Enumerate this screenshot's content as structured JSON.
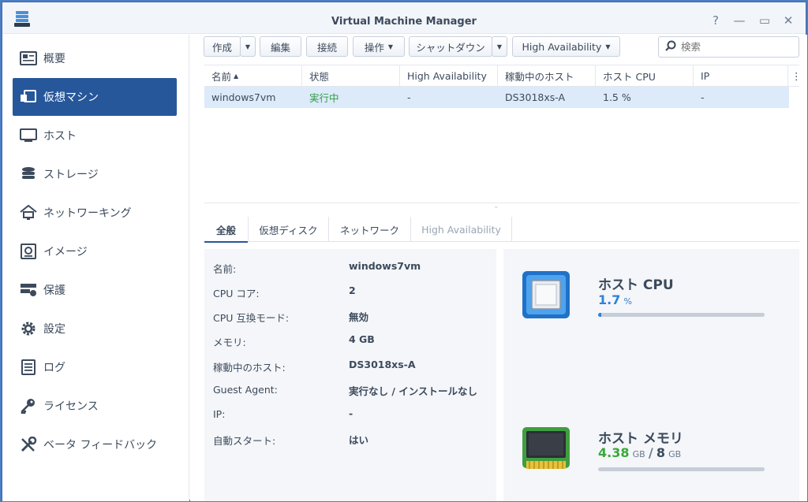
{
  "window": {
    "title": "Virtual Machine Manager",
    "help_glyph": "?",
    "minimize_glyph": "—",
    "maximize_glyph": "▭",
    "close_glyph": "✕"
  },
  "sidebar": {
    "items": [
      {
        "label": "概要",
        "icon": "overview-icon"
      },
      {
        "label": "仮想マシン",
        "icon": "virtual-machine-icon",
        "active": true
      },
      {
        "label": "ホスト",
        "icon": "host-monitor-icon"
      },
      {
        "label": "ストレージ",
        "icon": "storage-stack-icon"
      },
      {
        "label": "ネットワーキング",
        "icon": "network-icon"
      },
      {
        "label": "イメージ",
        "icon": "disk-image-icon"
      },
      {
        "label": "保護",
        "icon": "protection-icon"
      },
      {
        "label": "設定",
        "icon": "gear-icon"
      },
      {
        "label": "ログ",
        "icon": "log-icon"
      },
      {
        "label": "ライセンス",
        "icon": "key-icon"
      },
      {
        "label": "ベータ フィードバック",
        "icon": "tools-icon"
      }
    ]
  },
  "toolbar": {
    "create": "作成",
    "edit": "編集",
    "connect": "接続",
    "action": "操作",
    "shutdown": "シャットダウン",
    "high_availability": "High Availability",
    "search_placeholder": "検索"
  },
  "grid": {
    "columns": [
      "名前",
      "状態",
      "High Availability",
      "稼動中のホスト",
      "ホスト CPU",
      "IP"
    ],
    "sort_indicator": "▲",
    "rows": [
      {
        "name": "windows7vm",
        "status": "実行中",
        "ha": "-",
        "host": "DS3018xs-A",
        "cpu": "1.5 %",
        "ip": "-"
      }
    ]
  },
  "tabs": [
    "全般",
    "仮想ディスク",
    "ネットワーク",
    "High Availability"
  ],
  "details": {
    "rows": [
      {
        "label": "名前:",
        "value": "windows7vm"
      },
      {
        "label": "CPU コア:",
        "value": "2"
      },
      {
        "label": "CPU 互換モード:",
        "value": "無効"
      },
      {
        "label": "メモリ:",
        "value": "4 GB"
      },
      {
        "label": "稼動中のホスト:",
        "value": "DS3018xs-A"
      },
      {
        "label": "Guest Agent:",
        "value": "実行なし / インストールなし"
      },
      {
        "label": "IP:",
        "value": "-"
      },
      {
        "label": "自動スタート:",
        "value": "はい"
      }
    ]
  },
  "host_cpu": {
    "title": "ホスト CPU",
    "value": "1.7",
    "unit": "%",
    "percent": 1.7
  },
  "host_memory": {
    "title": "ホスト メモリ",
    "used": "4.38",
    "used_unit": "GB",
    "separator": "/",
    "total": "8",
    "total_unit": "GB",
    "percent": 0
  },
  "colors": {
    "accent": "#26579b",
    "running": "#2f9e44",
    "cpu_value": "#2e82d6",
    "mem_value": "#3aa83a"
  }
}
